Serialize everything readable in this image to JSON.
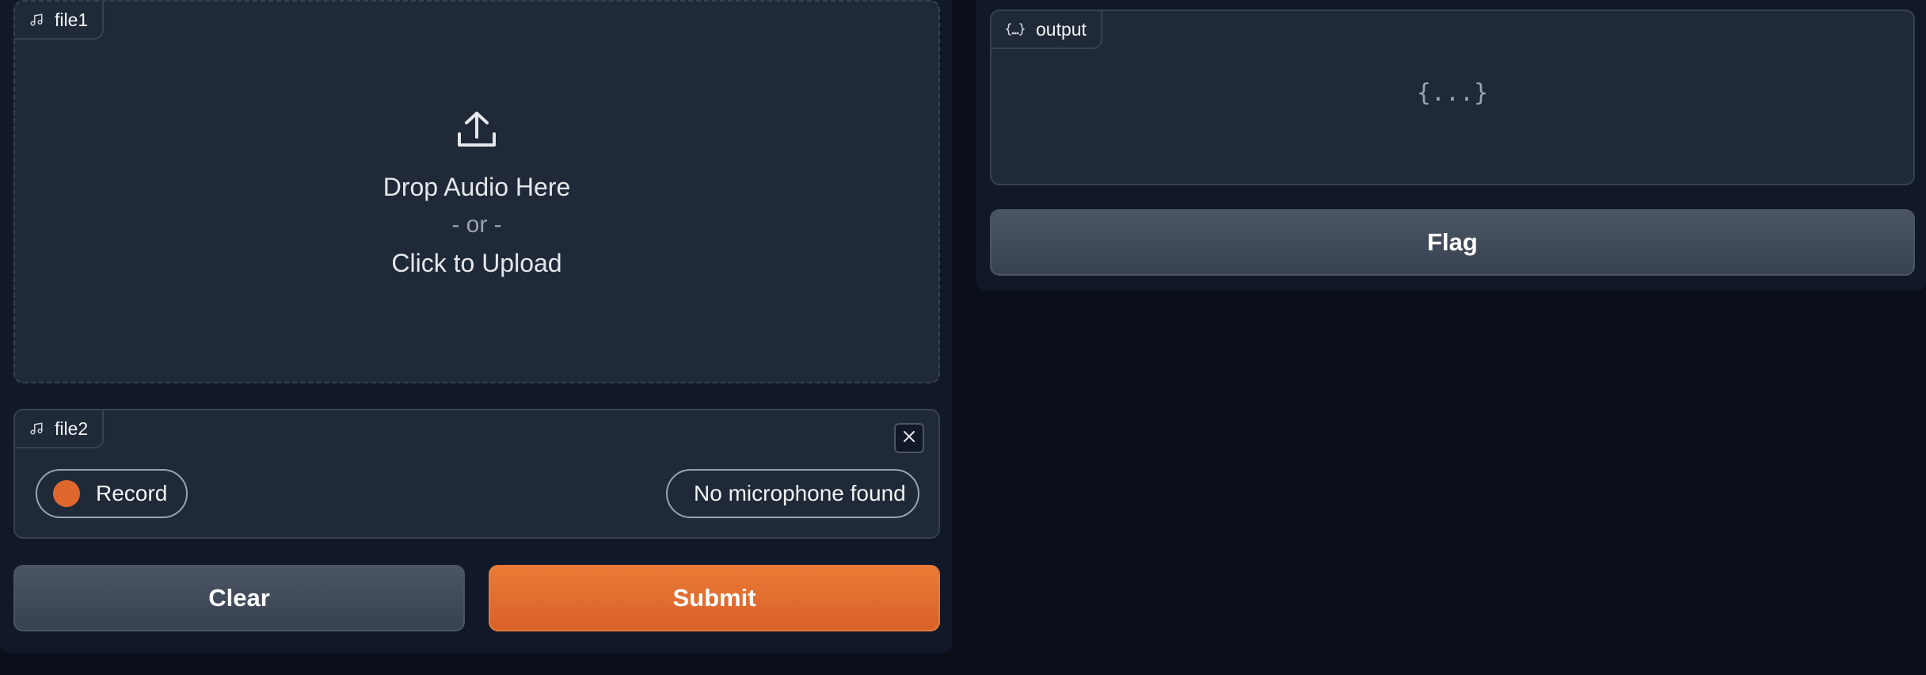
{
  "inputs": {
    "file1": {
      "label": "file1",
      "icon": "music-note-icon",
      "drop_text": "Drop Audio Here",
      "or_text": "- or -",
      "click_text": "Click to Upload"
    },
    "file2": {
      "label": "file2",
      "icon": "music-note-icon",
      "record_label": "Record",
      "microphone_status": "No microphone found"
    }
  },
  "actions": {
    "clear_label": "Clear",
    "submit_label": "Submit"
  },
  "output": {
    "label": "output",
    "icon": "json-braces-icon",
    "placeholder": "{...}",
    "flag_label": "Flag"
  },
  "colors": {
    "background": "#0b0f19",
    "panel": "#111827",
    "block": "#1f2937",
    "border": "#374151",
    "primary": "#e8702f",
    "record_dot": "#e0672e"
  }
}
